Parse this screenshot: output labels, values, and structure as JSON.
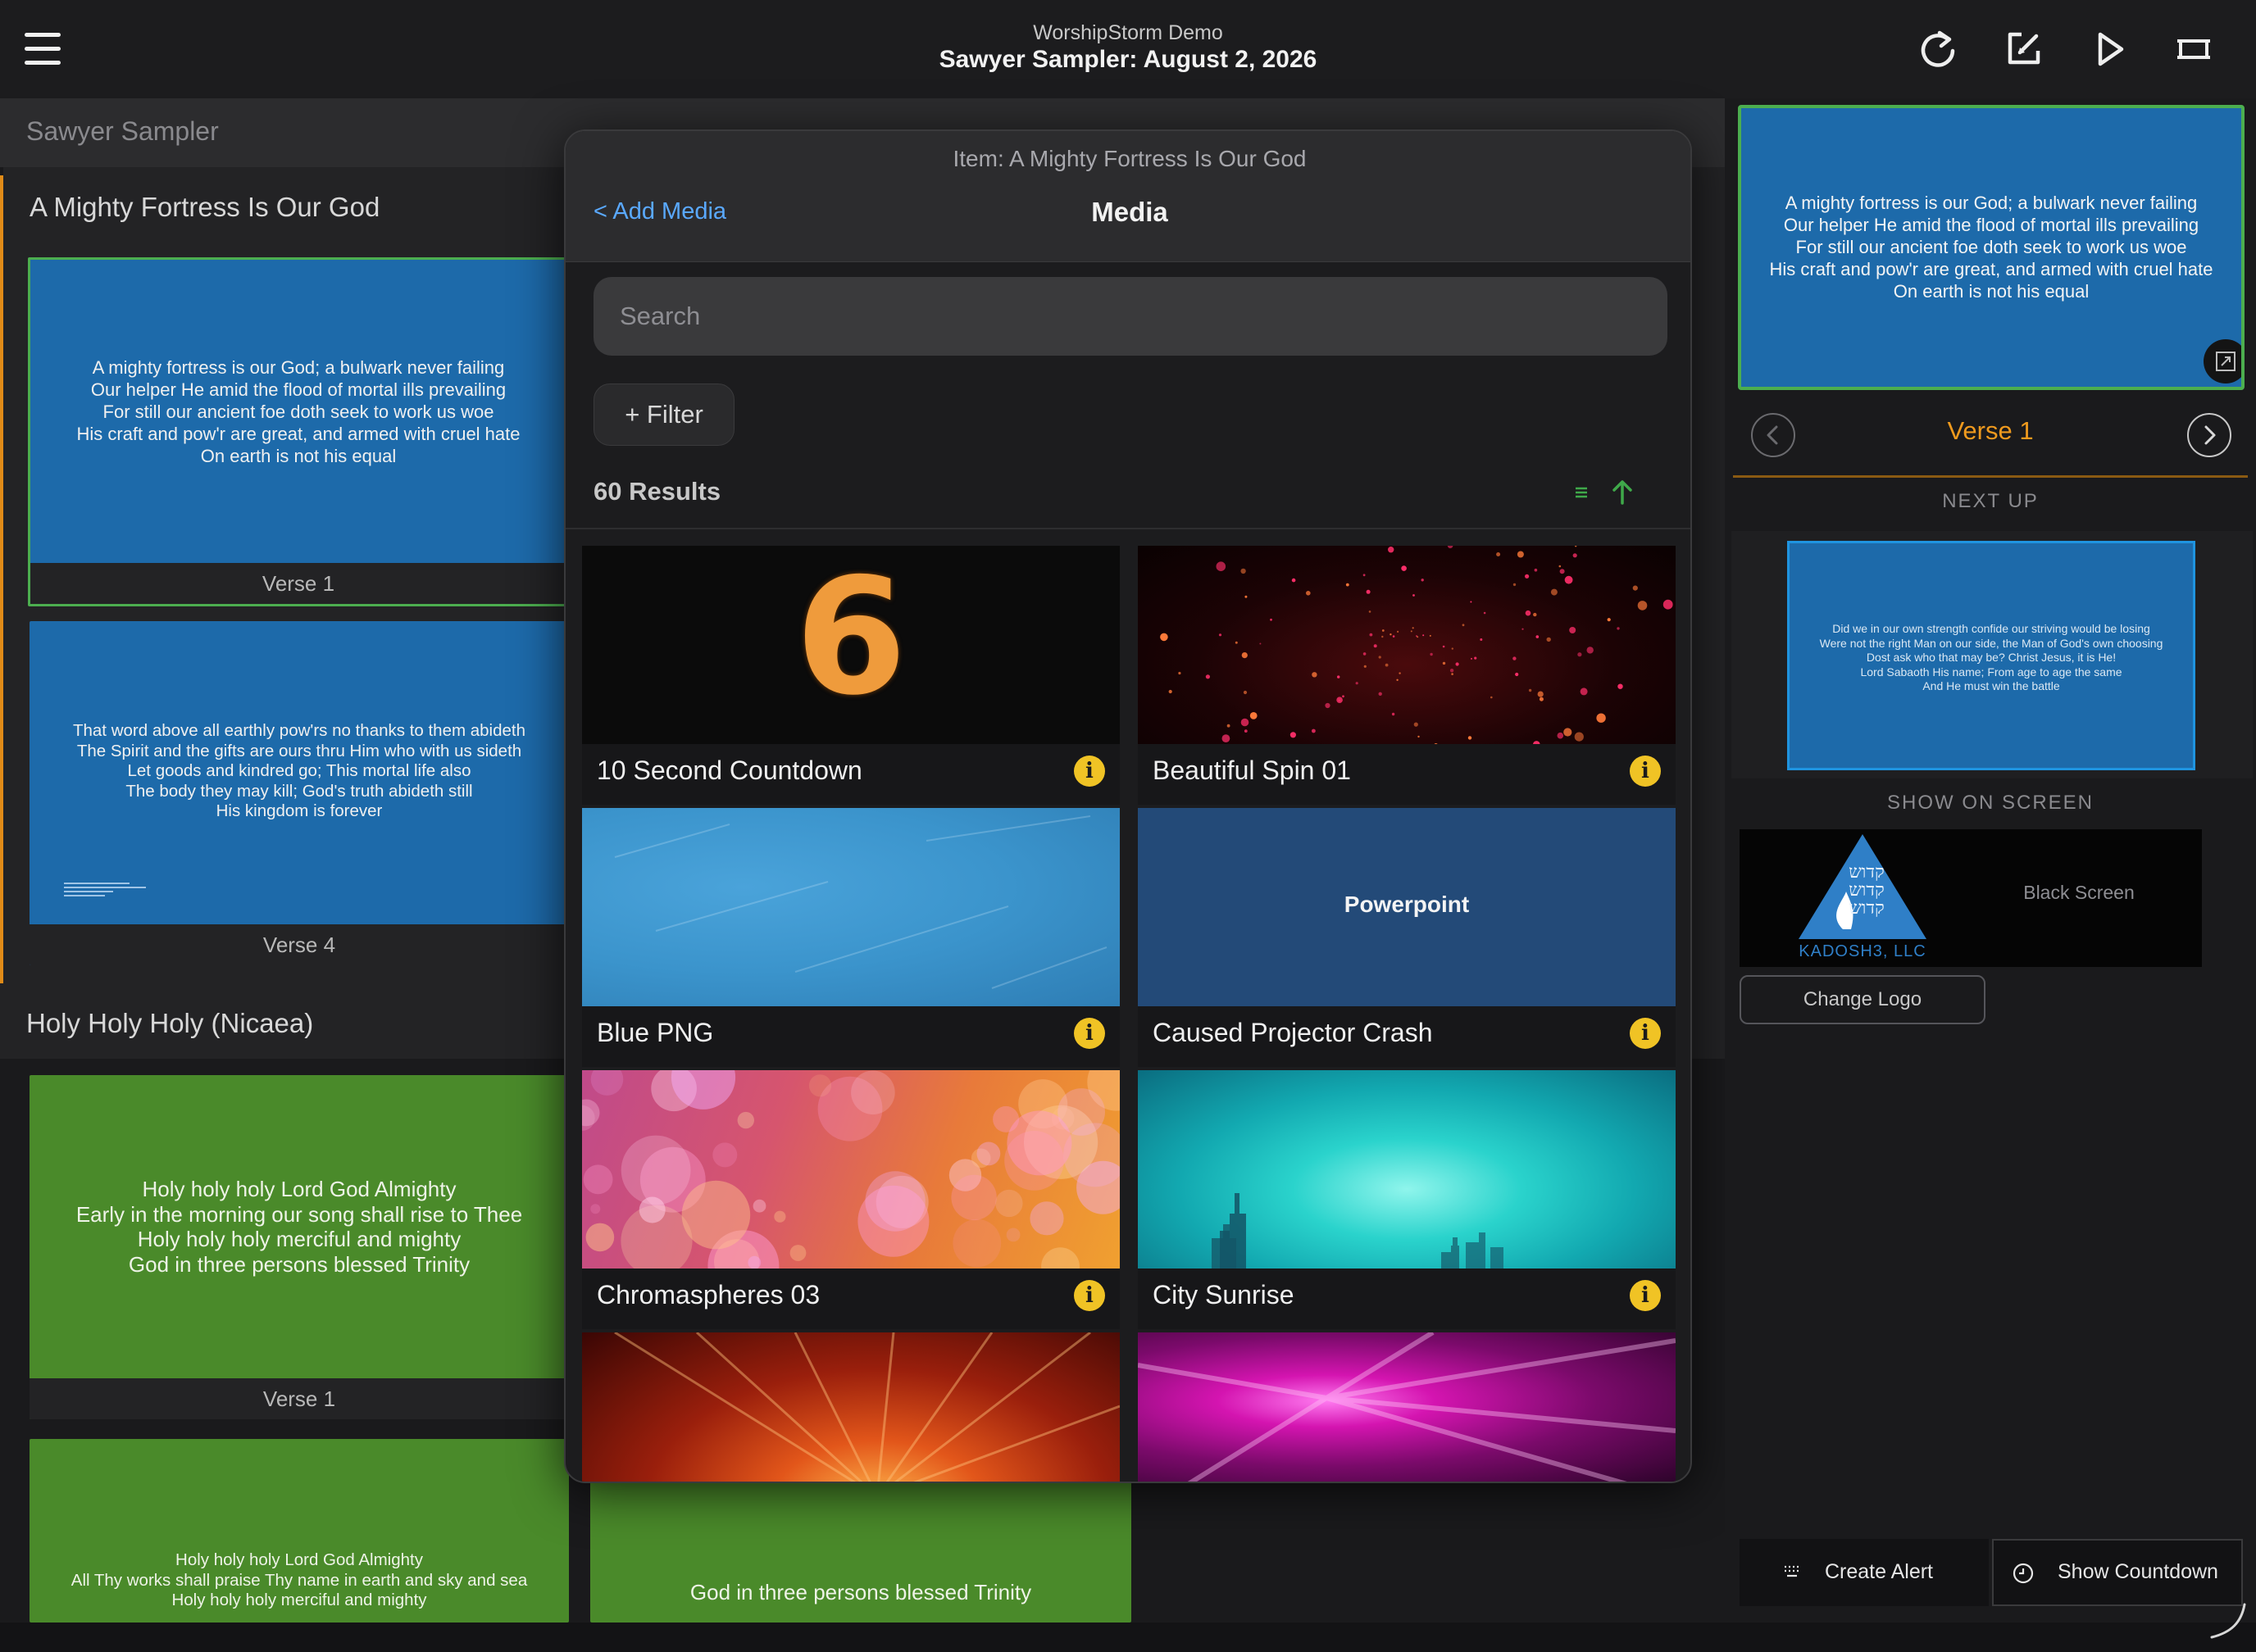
{
  "header": {
    "app_title": "WorshipStorm Demo",
    "doc_title": "Sawyer Sampler: August 2, 2026",
    "icons": [
      "menu-icon",
      "refresh-icon",
      "edit-icon",
      "play-icon",
      "screen-icon"
    ]
  },
  "service": {
    "name": "Sawyer Sampler",
    "songs": [
      {
        "title": "A Mighty Fortress Is Our God",
        "slides": [
          {
            "label": "Verse 1",
            "lines": [
              "A mighty fortress is our God; a bulwark never failing",
              "Our helper He amid the flood of mortal ills prevailing",
              "For still our ancient foe doth seek to work us woe",
              "His craft and pow'r are great, and armed with cruel hate",
              "On earth is not his equal"
            ]
          },
          {
            "label": "Verse 4",
            "lines": [
              "That word above all earthly pow'rs no thanks to them abideth",
              "The Spirit and the gifts are ours thru Him who with us sideth",
              "Let goods and kindred go; This mortal life also",
              "The body they may kill; God's truth abideth still",
              "His kingdom is forever"
            ]
          }
        ]
      },
      {
        "title": "Holy Holy Holy (Nicaea)",
        "slides": [
          {
            "label": "Verse 1",
            "lines": [
              "Holy holy holy Lord God Almighty",
              "Early in the morning our song shall rise to Thee",
              "Holy holy holy merciful and mighty",
              "God in three persons blessed Trinity"
            ]
          },
          {
            "label": "",
            "lines": [
              "Holy holy holy Lord God Almighty",
              "All Thy works shall praise Thy name in earth and sky and sea",
              "Holy holy holy merciful and mighty"
            ]
          },
          {
            "label": "",
            "lines": [
              "God in three persons blessed Trinity"
            ]
          }
        ]
      }
    ]
  },
  "modal": {
    "item_title": "Item: A Mighty Fortress Is Our God",
    "back_label": "< Add Media",
    "title": "Media",
    "search_placeholder": "Search",
    "filter_label": "+ Filter",
    "results_label": "60 Results",
    "media": [
      {
        "name": "10 Second Countdown",
        "thumb": "countdown-six",
        "badge": "i"
      },
      {
        "name": "Beautiful Spin 01",
        "thumb": "red-particles",
        "badge": "i"
      },
      {
        "name": "Blue PNG",
        "thumb": "blue-texture",
        "badge": "i"
      },
      {
        "name": "Caused Projector Crash",
        "thumb": "Powerpoint",
        "badge": "i"
      },
      {
        "name": "Chromaspheres 03",
        "thumb": "bokeh",
        "badge": "i"
      },
      {
        "name": "City Sunrise",
        "thumb": "teal-city",
        "badge": "i"
      },
      {
        "name": "",
        "thumb": "orange-rays",
        "badge": ""
      },
      {
        "name": "",
        "thumb": "magenta-rays",
        "badge": ""
      }
    ],
    "countdown_digit": "6"
  },
  "live": {
    "lines": [
      "A mighty fortress is our God; a bulwark never failing",
      "Our helper He amid the flood of mortal ills prevailing",
      "For still our ancient foe doth seek to work us woe",
      "His craft and pow'r are great, and armed with cruel hate",
      "On earth is not his equal"
    ],
    "verse_label": "Verse 1",
    "next_up_label": "NEXT UP",
    "next_lines": [
      "Did we in our own strength confide our striving would be losing",
      "Were not the right Man on our side, the Man of God's own choosing",
      "Dost ask who that may be? Christ Jesus, it is He!",
      "Lord Sabaoth His name; From age to age the same",
      "And He must win the battle"
    ],
    "show_on_screen_label": "SHOW ON SCREEN",
    "logo_text": "KADOSH3, LLC",
    "logo_hebrew": [
      "קדוש",
      "קדוש",
      "קדוש"
    ],
    "black_screen_label": "Black Screen",
    "change_logo_label": "Change Logo",
    "create_alert_label": "Create Alert",
    "show_countdown_label": "Show Countdown"
  },
  "colors": {
    "accent_blue": "#5aa9ff",
    "slide_blue": "#1d6aaa",
    "slide_green": "#4a8a2a",
    "live_border": "#4cae4f",
    "verse_orange": "#ef9a1e",
    "info_badge": "#f0c325"
  }
}
